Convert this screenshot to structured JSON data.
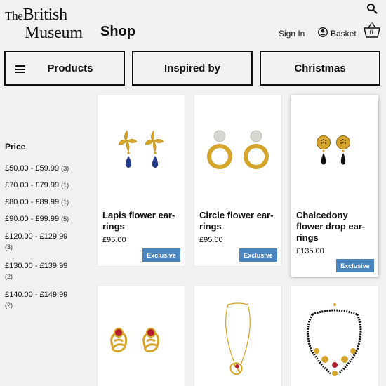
{
  "brand": {
    "logo_line1_the": "The",
    "logo_line1_word": "British",
    "logo_line2": "Museum",
    "shop": "Shop"
  },
  "header": {
    "signin": "Sign In",
    "basket": "Basket",
    "basket_count": "0"
  },
  "nav": {
    "products": "Products",
    "inspired": "Inspired by",
    "christmas": "Christmas"
  },
  "filter": {
    "title": "Price",
    "items": [
      {
        "range": "£50.00 - £59.99",
        "count": "(3)"
      },
      {
        "range": "£70.00 - £79.99",
        "count": "(1)"
      },
      {
        "range": "£80.00 - £89.99",
        "count": "(1)"
      },
      {
        "range": "£90.00 - £99.99",
        "count": "(5)"
      },
      {
        "range": "£120.00 - £129.99",
        "count": "(3)"
      },
      {
        "range": "£130.00 - £139.99",
        "count": "(2)"
      },
      {
        "range": "£140.00 - £149.99",
        "count": "(2)"
      }
    ]
  },
  "products": [
    {
      "name": "Lapis flower ear-rings",
      "price": "£95.00",
      "badge": "Exclusive"
    },
    {
      "name": "Circle flower ear-rings",
      "price": "£95.00",
      "badge": "Exclusive"
    },
    {
      "name": "Chalcedony flower drop ear-rings",
      "price": "£135.00",
      "badge": "Exclusive"
    }
  ],
  "colors": {
    "badge": "#4a86bd",
    "gold": "#d4a52a",
    "background": "#f2f2f2"
  },
  "icons": [
    "search-icon",
    "user-icon",
    "basket-icon",
    "menu-icon"
  ]
}
